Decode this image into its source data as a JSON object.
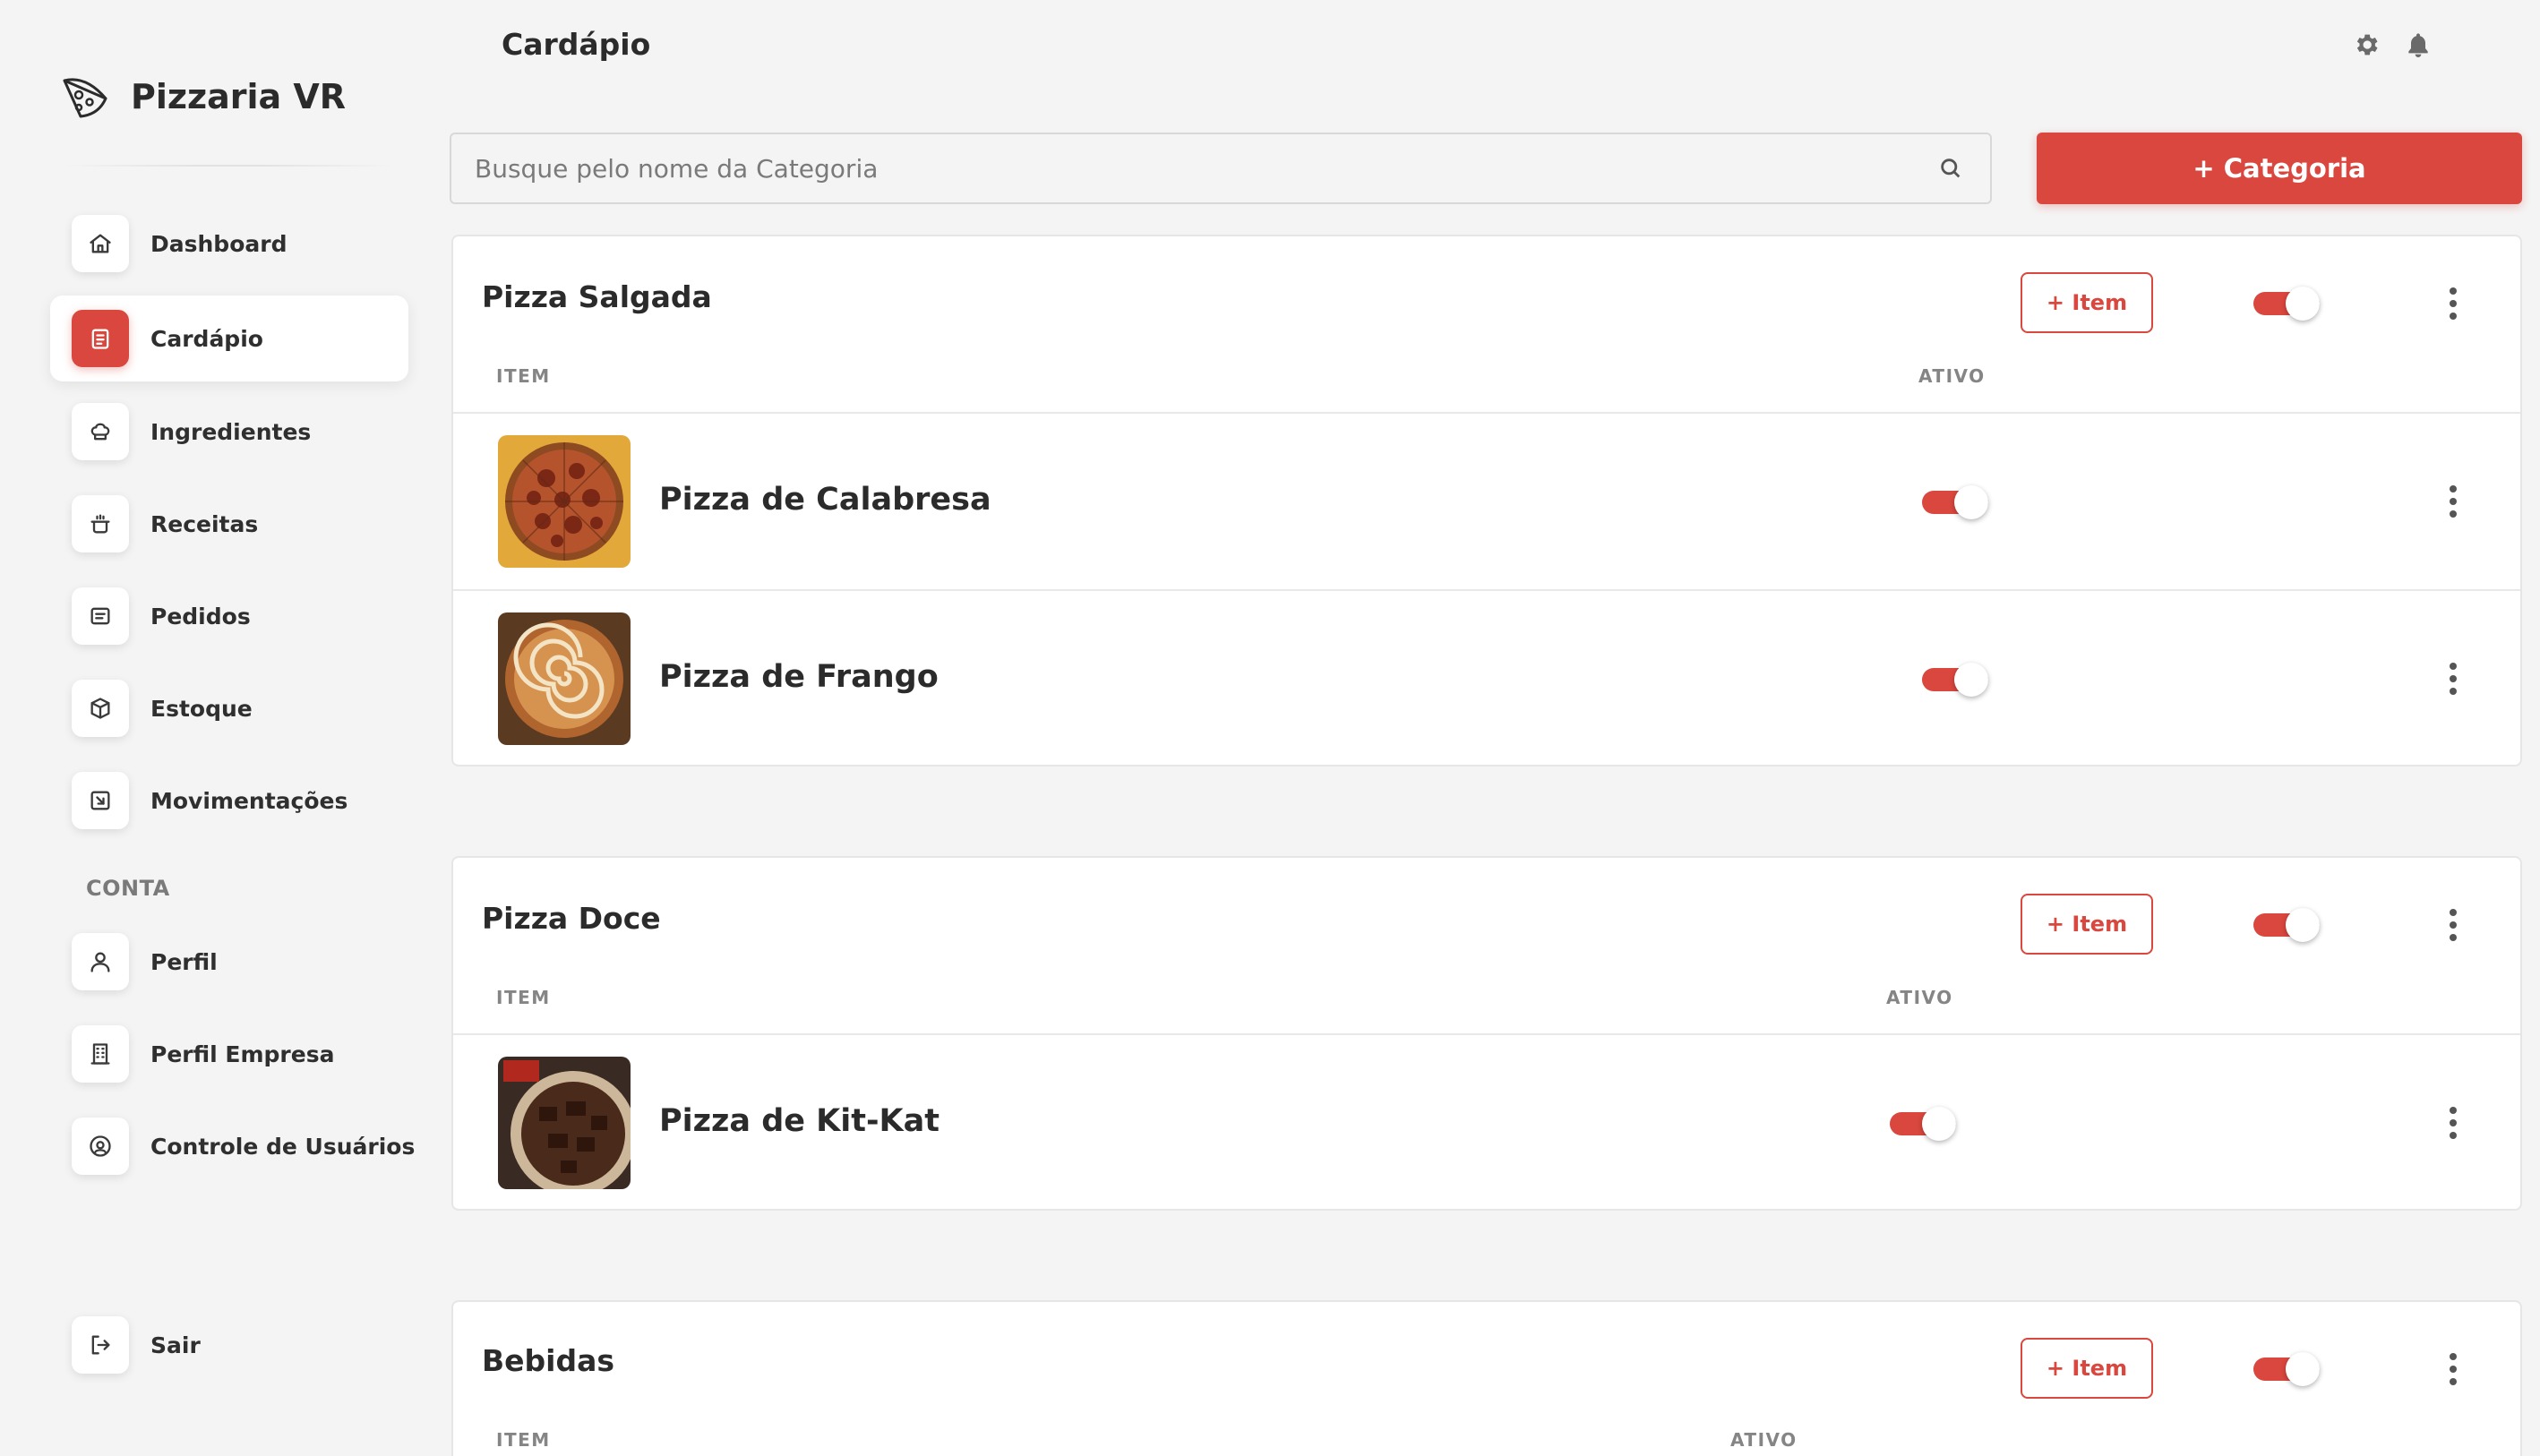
{
  "brand": {
    "name": "Pizzaria VR",
    "icon": "pizza-slice-icon"
  },
  "colors": {
    "accent": "#d9473e",
    "background": "#f4f4f4",
    "card": "#ffffff"
  },
  "sidebar": {
    "items": [
      {
        "label": "Dashboard",
        "icon": "home-icon",
        "active": false
      },
      {
        "label": "Cardápio",
        "icon": "menu-clipboard-icon",
        "active": true
      },
      {
        "label": "Ingredientes",
        "icon": "chef-hat-icon",
        "active": false
      },
      {
        "label": "Receitas",
        "icon": "pot-icon",
        "active": false
      },
      {
        "label": "Pedidos",
        "icon": "receipt-icon",
        "active": false
      },
      {
        "label": "Estoque",
        "icon": "box-icon",
        "active": false
      },
      {
        "label": "Movimentações",
        "icon": "transfer-icon",
        "active": false
      }
    ],
    "account_section": "CONTA",
    "account_items": [
      {
        "label": "Perfil",
        "icon": "user-icon"
      },
      {
        "label": "Perfil Empresa",
        "icon": "building-icon"
      },
      {
        "label": "Controle de Usuários",
        "icon": "user-circle-icon"
      }
    ],
    "logout": {
      "label": "Sair",
      "icon": "logout-icon"
    }
  },
  "header": {
    "title": "Cardápio",
    "icons": [
      "gear-icon",
      "bell-icon"
    ]
  },
  "search": {
    "placeholder": "Busque pelo nome da Categoria",
    "value": ""
  },
  "add_category_label": "+ Categoria",
  "categories": [
    {
      "name": "Pizza Salgada",
      "add_item_label": "+ Item",
      "active": true,
      "col_item": "ITEM",
      "col_active": "ATIVO",
      "items": [
        {
          "name": "Pizza de Calabresa",
          "active": true,
          "image": "pepperoni-pizza-photo"
        },
        {
          "name": "Pizza de Frango",
          "active": true,
          "image": "chicken-pizza-photo"
        }
      ]
    },
    {
      "name": "Pizza Doce",
      "add_item_label": "+ Item",
      "active": true,
      "col_item": "ITEM",
      "col_active": "ATIVO",
      "items": [
        {
          "name": "Pizza de Kit-Kat",
          "active": true,
          "image": "kitkat-pizza-photo"
        }
      ]
    },
    {
      "name": "Bebidas",
      "add_item_label": "+ Item",
      "active": true,
      "col_item": "ITEM",
      "col_active": "ATIVO",
      "items": []
    }
  ]
}
